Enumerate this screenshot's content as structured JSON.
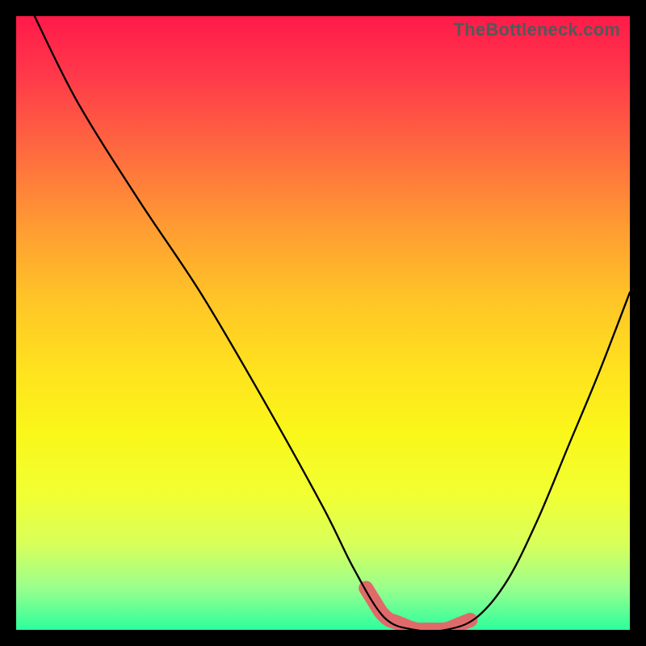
{
  "watermark": "TheBottleneck.com",
  "colors": {
    "black": "#000000",
    "pink_segment": "#e06a6a",
    "gradient_top": "#ff1a49",
    "gradient_bottom": "#2dff9d"
  },
  "chart_data": {
    "type": "line",
    "title": "",
    "xlabel": "",
    "ylabel": "",
    "xlim": [
      0,
      100
    ],
    "ylim": [
      0,
      100
    ],
    "grid": false,
    "legend": false,
    "series": [
      {
        "name": "bottleneck-curve",
        "x": [
          3,
          10,
          20,
          30,
          40,
          50,
          55,
          60,
          65,
          70,
          75,
          80,
          85,
          90,
          95,
          100
        ],
        "y": [
          100,
          86,
          70,
          55,
          38,
          20,
          10,
          2,
          0,
          0,
          2,
          8,
          18,
          30,
          42,
          55
        ]
      }
    ],
    "annotations": [
      {
        "name": "pink-valley-segment",
        "x_start": 57,
        "x_end": 74,
        "note": "highlighted flat bottom region"
      }
    ]
  }
}
